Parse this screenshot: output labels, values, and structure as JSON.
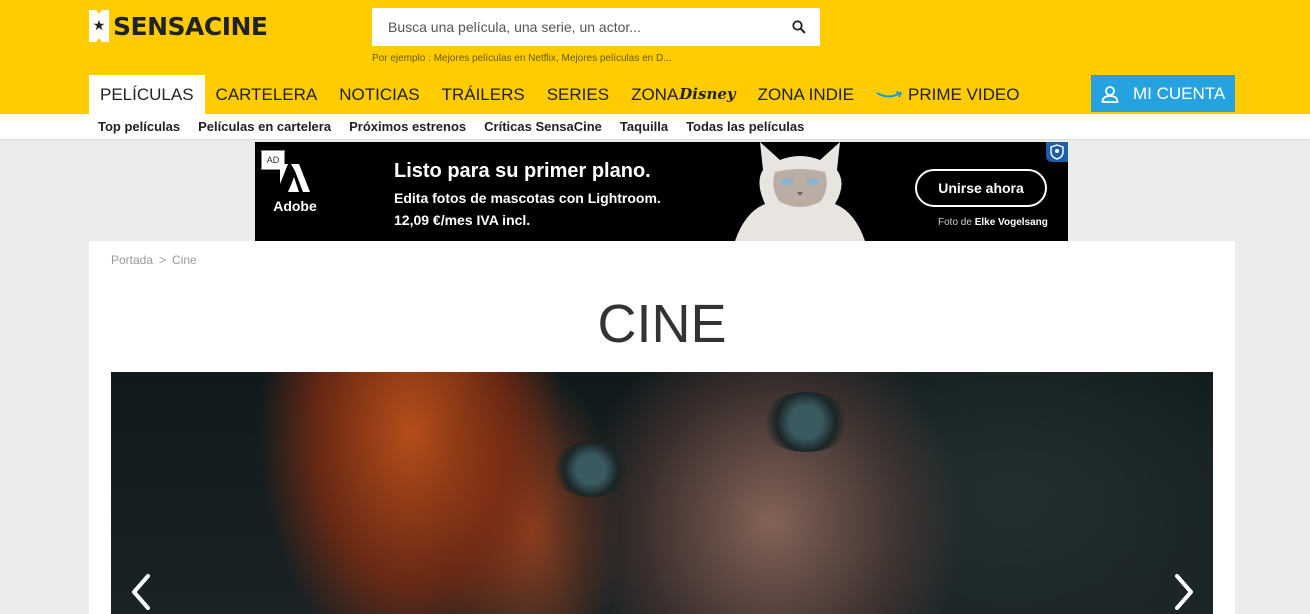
{
  "brand": {
    "name": "SENSACINE"
  },
  "search": {
    "placeholder": "Busca una película, una serie, un actor...",
    "hint": "Por ejemplo : Mejores películas en Netflix, Mejores películas en D..."
  },
  "main_nav": [
    {
      "label": "PELÍCULAS",
      "active": true
    },
    {
      "label": "CARTELERA"
    },
    {
      "label": "NOTICIAS"
    },
    {
      "label": "TRÁILERS"
    },
    {
      "label": "SERIES"
    },
    {
      "label": "ZONA",
      "suffix": "Disney"
    },
    {
      "label": "ZONA INDIE"
    },
    {
      "label": "PRIME VIDEO"
    }
  ],
  "account": {
    "label": "MI CUENTA"
  },
  "sub_nav": [
    "Top películas",
    "Películas en cartelera",
    "Próximos estrenos",
    "Críticas SensaCine",
    "Taquilla",
    "Todas las películas"
  ],
  "ad": {
    "badge": "AD",
    "brand": "Adobe",
    "headline": "Listo para su primer plano.",
    "line1": "Edita fotos de mascotas con Lightroom.",
    "line2": "12,09 €/mes IVA incl.",
    "cta": "Unirse ahora",
    "credit_prefix": "Foto de",
    "credit_name": "Elke Vogelsang"
  },
  "breadcrumb": {
    "home": "Portada",
    "separator": ">",
    "current": "Cine"
  },
  "page": {
    "title": "CINE"
  },
  "colors": {
    "header": "#fecc00",
    "account": "#24a3e0"
  }
}
